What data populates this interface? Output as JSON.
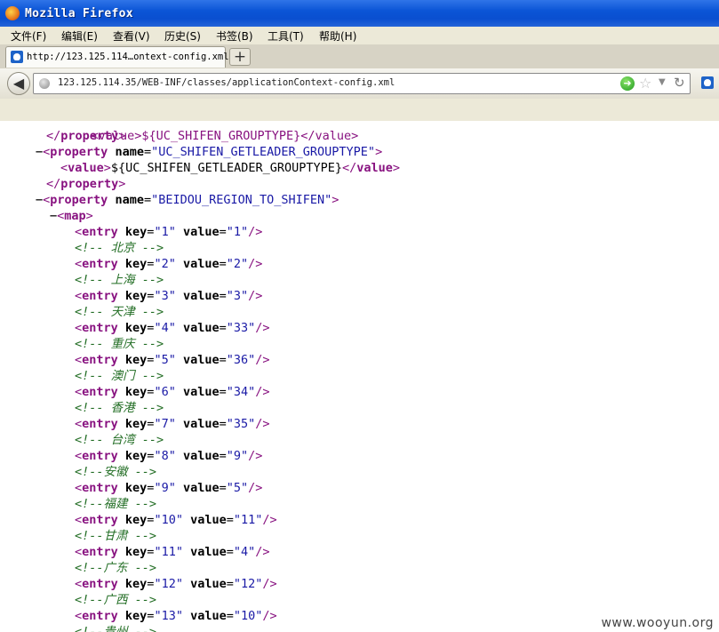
{
  "window": {
    "title": "Mozilla Firefox"
  },
  "menu": [
    "文件(F)",
    "编辑(E)",
    "查看(V)",
    "历史(S)",
    "书签(B)",
    "工具(T)",
    "帮助(H)"
  ],
  "tab": {
    "label": "http://123.125.114…ontext-config.xml",
    "new_tab": "+"
  },
  "toolbar": {
    "url": "123.125.114.35/WEB-INF/classes/applicationContext-config.xml"
  },
  "watermark": "www.wooyun.org",
  "xml": {
    "partial_top": "<value>${UC_SHIFEN_GROUPTYPE}</value>",
    "lines": [
      {
        "kind": "close",
        "indent": 1,
        "tag": "property"
      },
      {
        "kind": "open",
        "indent": 0,
        "collapse": true,
        "tag": "property",
        "attr": "name",
        "value": "UC_SHIFEN_GETLEADER_GROUPTYPE"
      },
      {
        "kind": "value",
        "indent": 2,
        "tag": "value",
        "text": "${UC_SHIFEN_GETLEADER_GROUPTYPE}"
      },
      {
        "kind": "close",
        "indent": 1,
        "tag": "property"
      },
      {
        "kind": "open",
        "indent": 0,
        "collapse": true,
        "tag": "property",
        "attr": "name",
        "value": "BEIDOU_REGION_TO_SHIFEN"
      },
      {
        "kind": "map",
        "indent": 1,
        "collapse": true,
        "tag": "map"
      },
      {
        "kind": "entry",
        "key": "1",
        "value": "1"
      },
      {
        "kind": "comment",
        "text": "<!-- 北京 -->"
      },
      {
        "kind": "entry",
        "key": "2",
        "value": "2"
      },
      {
        "kind": "comment",
        "text": "<!-- 上海 -->"
      },
      {
        "kind": "entry",
        "key": "3",
        "value": "3"
      },
      {
        "kind": "comment",
        "text": "<!-- 天津 -->"
      },
      {
        "kind": "entry",
        "key": "4",
        "value": "33"
      },
      {
        "kind": "comment",
        "text": "<!-- 重庆 -->"
      },
      {
        "kind": "entry",
        "key": "5",
        "value": "36"
      },
      {
        "kind": "comment",
        "text": "<!-- 澳门 -->"
      },
      {
        "kind": "entry",
        "key": "6",
        "value": "34"
      },
      {
        "kind": "comment",
        "text": "<!-- 香港 -->"
      },
      {
        "kind": "entry",
        "key": "7",
        "value": "35"
      },
      {
        "kind": "comment",
        "text": "<!-- 台湾 -->"
      },
      {
        "kind": "entry",
        "key": "8",
        "value": "9"
      },
      {
        "kind": "comment",
        "text": "<!--安徽 -->"
      },
      {
        "kind": "entry",
        "key": "9",
        "value": "5"
      },
      {
        "kind": "comment",
        "text": "<!--福建 -->"
      },
      {
        "kind": "entry",
        "key": "10",
        "value": "11"
      },
      {
        "kind": "comment",
        "text": "<!--甘肃 -->"
      },
      {
        "kind": "entry",
        "key": "11",
        "value": "4"
      },
      {
        "kind": "comment",
        "text": "<!--广东 -->"
      },
      {
        "kind": "entry",
        "key": "12",
        "value": "12"
      },
      {
        "kind": "comment",
        "text": "<!--广西 -->"
      },
      {
        "kind": "entry",
        "key": "13",
        "value": "10"
      },
      {
        "kind": "comment",
        "text": "<!--贵州 -->"
      }
    ]
  },
  "colors": {
    "tag": "#881280",
    "attr_value": "#1a1aa6",
    "comment": "#236e25",
    "titlebar": "#0b55d6"
  }
}
